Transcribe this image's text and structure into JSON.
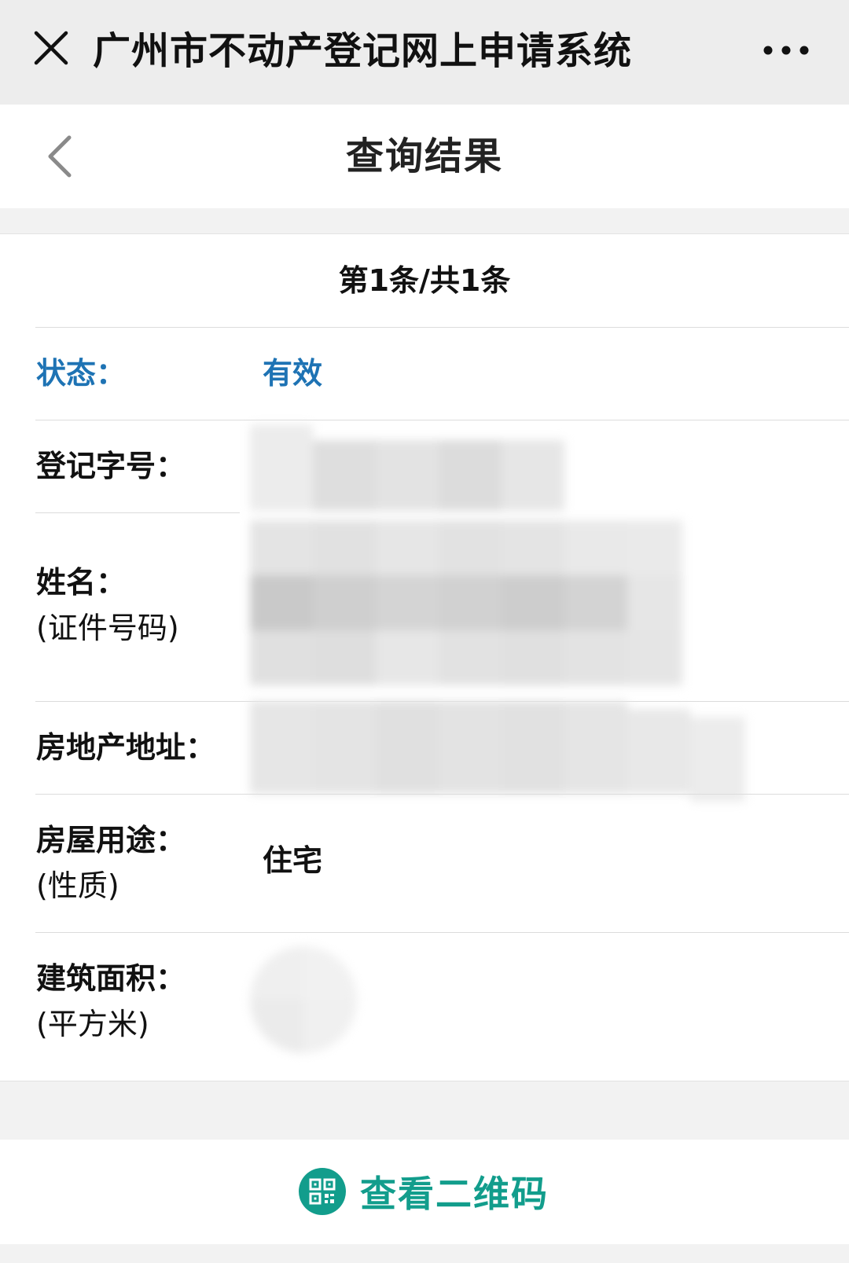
{
  "topbar": {
    "title": "广州市不动产登记网上申请系统",
    "close_icon": "close-icon",
    "more_icon": "more-horizontal-icon"
  },
  "header": {
    "title": "查询结果",
    "back_icon": "chevron-left-icon"
  },
  "result": {
    "pager": "第1条/共1条",
    "status": {
      "label": "状态：",
      "value": "有效",
      "color": "#1e73b4"
    },
    "reg_no": {
      "label": "登记字号："
    },
    "name": {
      "label": "姓名：",
      "sub_label": "(证件号码)"
    },
    "address": {
      "label": "房地产地址："
    },
    "usage": {
      "label": "房屋用途：",
      "sub_label": "(性质)",
      "value": "住宅"
    },
    "area": {
      "label": "建筑面积：",
      "sub_label": "(平方米)"
    }
  },
  "bottom": {
    "qr_label": "查看二维码",
    "qr_icon": "qr-code-icon",
    "accent": "#129d8c"
  }
}
